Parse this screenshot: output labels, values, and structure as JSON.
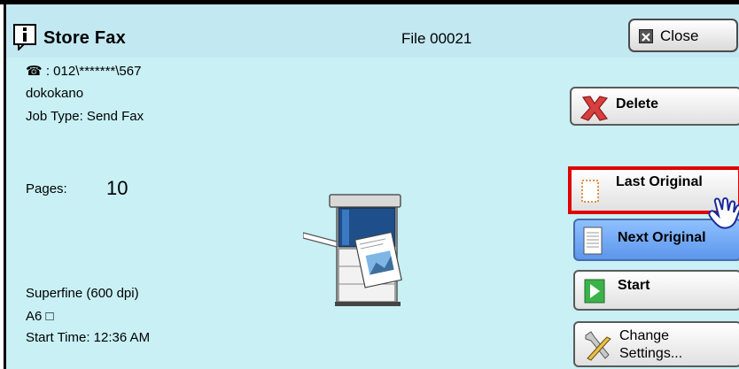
{
  "header": {
    "title": "Store Fax",
    "file": "File 00021",
    "close_label": "Close"
  },
  "info": {
    "phone": "☎ : 012\\*******\\567",
    "name": "dokokano",
    "job_type": "Job Type: Send Fax",
    "pages_label": "Pages:",
    "pages_value": "10",
    "resolution": "Superfine (600 dpi)",
    "paper": "A6 □",
    "start_time": "Start Time: 12:36 AM"
  },
  "buttons": {
    "delete": "Delete",
    "last_original": "Last Original",
    "next_original": "Next Original",
    "start": "Start",
    "change_settings_line1": "Change",
    "change_settings_line2": "Settings..."
  },
  "colors": {
    "content_bg": "#c8f0f5",
    "title_bg": "#c2e8f2",
    "highlight": "#e00000",
    "selected_button": "#6fa8f5"
  }
}
